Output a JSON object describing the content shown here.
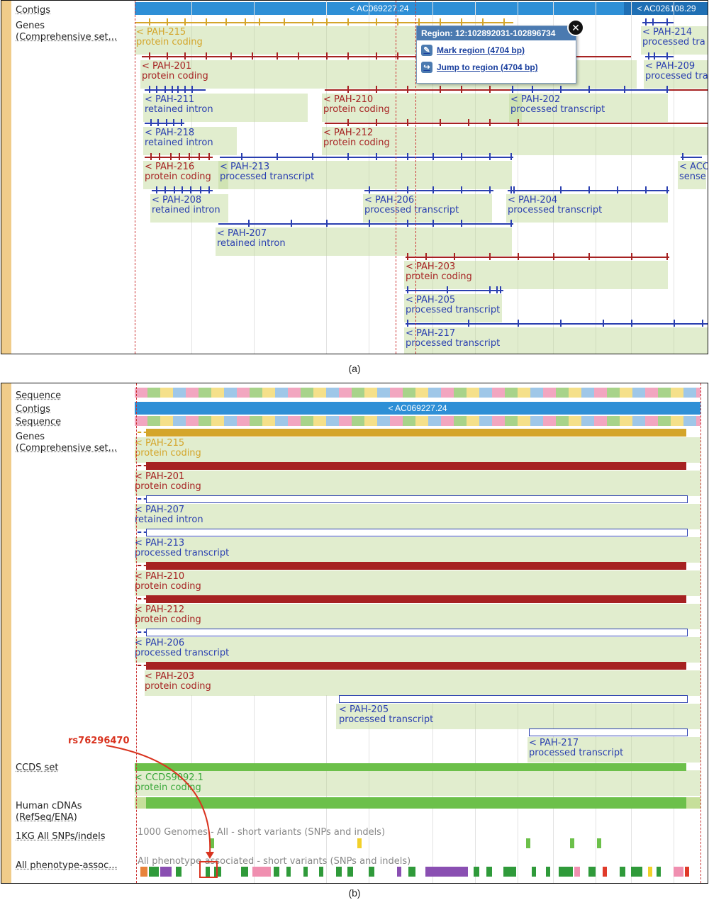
{
  "panel_a": {
    "caption": "(a)",
    "sidebar": {
      "contigs": "Contigs",
      "genes_1": "Genes",
      "genes_2": "(Comprehensive set..."
    },
    "contigs": [
      {
        "label": "< AC069227.24"
      },
      {
        "label": "< AC026108.29"
      }
    ],
    "popup": {
      "title": "Region: 12:102892031-102896734",
      "mark": "Mark region (4704 bp)",
      "jump": "Jump to region (4704 bp)",
      "close_icon": "close-icon",
      "mark_icon": "pencil-icon",
      "jump_icon": "jump-arrow-icon"
    },
    "transcripts": [
      {
        "name": "< PAH-215",
        "type": "protein coding",
        "color": "#d4a52a"
      },
      {
        "name": "< PAH-201",
        "type": "protein coding",
        "color": "#a62222"
      },
      {
        "name": "< PAH-211",
        "type": "retained intron",
        "color": "#2a3fb0"
      },
      {
        "name": "< PAH-218",
        "type": "retained intron",
        "color": "#2a3fb0"
      },
      {
        "name": "< PAH-216",
        "type": "protein coding",
        "color": "#a62222"
      },
      {
        "name": "< PAH-208",
        "type": "retained intron",
        "color": "#2a3fb0"
      },
      {
        "name": "< PAH-210",
        "type": "protein coding",
        "color": "#a62222"
      },
      {
        "name": "< PAH-212",
        "type": "protein coding",
        "color": "#a62222"
      },
      {
        "name": "< PAH-213",
        "type": "processed transcript",
        "color": "#2a3fb0"
      },
      {
        "name": "< PAH-206",
        "type": "processed transcript",
        "color": "#2a3fb0"
      },
      {
        "name": "< PAH-207",
        "type": "retained intron",
        "color": "#2a3fb0"
      },
      {
        "name": "< PAH-203",
        "type": "protein coding",
        "color": "#a62222"
      },
      {
        "name": "< PAH-205",
        "type": "processed transcript",
        "color": "#2a3fb0"
      },
      {
        "name": "< PAH-217",
        "type": "processed transcript",
        "color": "#2a3fb0"
      },
      {
        "name": "< PAH-202",
        "type": "processed transcript",
        "color": "#2a3fb0"
      },
      {
        "name": "< PAH-204",
        "type": "processed transcript",
        "color": "#2a3fb0"
      },
      {
        "name": "< PAH-214",
        "type": "processed tra",
        "color": "#2a3fb0"
      },
      {
        "name": "< PAH-209",
        "type": "processed tra",
        "color": "#2a3fb0"
      },
      {
        "name": "< ACC",
        "type": "sense",
        "color": "#2a3fb0"
      }
    ]
  },
  "panel_b": {
    "caption": "(b)",
    "sidebar": {
      "sequence1": "Sequence",
      "contigs": "Contigs",
      "sequence2": "Sequence",
      "genes_1": "Genes",
      "genes_2": "(Comprehensive set...",
      "ccds": "CCDS set",
      "cdna_1": "Human cDNAs",
      "cdna_2": "(RefSeq/ENA)",
      "kg": "1KG All SNPs/indels",
      "pheno": "All phenotype-assoc..."
    },
    "contig": "< AC069227.24",
    "transcripts": [
      {
        "name": "< PAH-215",
        "type": "protein coding",
        "color": "#d4a52a",
        "style": "solid"
      },
      {
        "name": "< PAH-201",
        "type": "protein coding",
        "color": "#a62222",
        "style": "solid"
      },
      {
        "name": "< PAH-207",
        "type": "retained intron",
        "color": "#2a3fb0",
        "style": "outline"
      },
      {
        "name": "< PAH-213",
        "type": "processed transcript",
        "color": "#2a3fb0",
        "style": "outline"
      },
      {
        "name": "< PAH-210",
        "type": "protein coding",
        "color": "#a62222",
        "style": "solid"
      },
      {
        "name": "< PAH-212",
        "type": "protein coding",
        "color": "#a62222",
        "style": "solid"
      },
      {
        "name": "< PAH-206",
        "type": "processed transcript",
        "color": "#2a3fb0",
        "style": "outline"
      },
      {
        "name": "< PAH-203",
        "type": "protein coding",
        "color": "#a62222",
        "style": "solid"
      },
      {
        "name": "< PAH-205",
        "type": "processed transcript",
        "color": "#2a3fb0",
        "style": "outline"
      },
      {
        "name": "< PAH-217",
        "type": "processed transcript",
        "color": "#2a3fb0",
        "style": "outline"
      }
    ],
    "ccds": {
      "name": "< CCDS9092.1",
      "type": "protein coding",
      "color": "#6cc04a"
    },
    "kg_track": "1000 Genomes - All - short variants (SNPs and indels)",
    "pheno_track": "All phenotype-associated - short variants (SNPs and indels)",
    "annotation": "rs76296470"
  }
}
